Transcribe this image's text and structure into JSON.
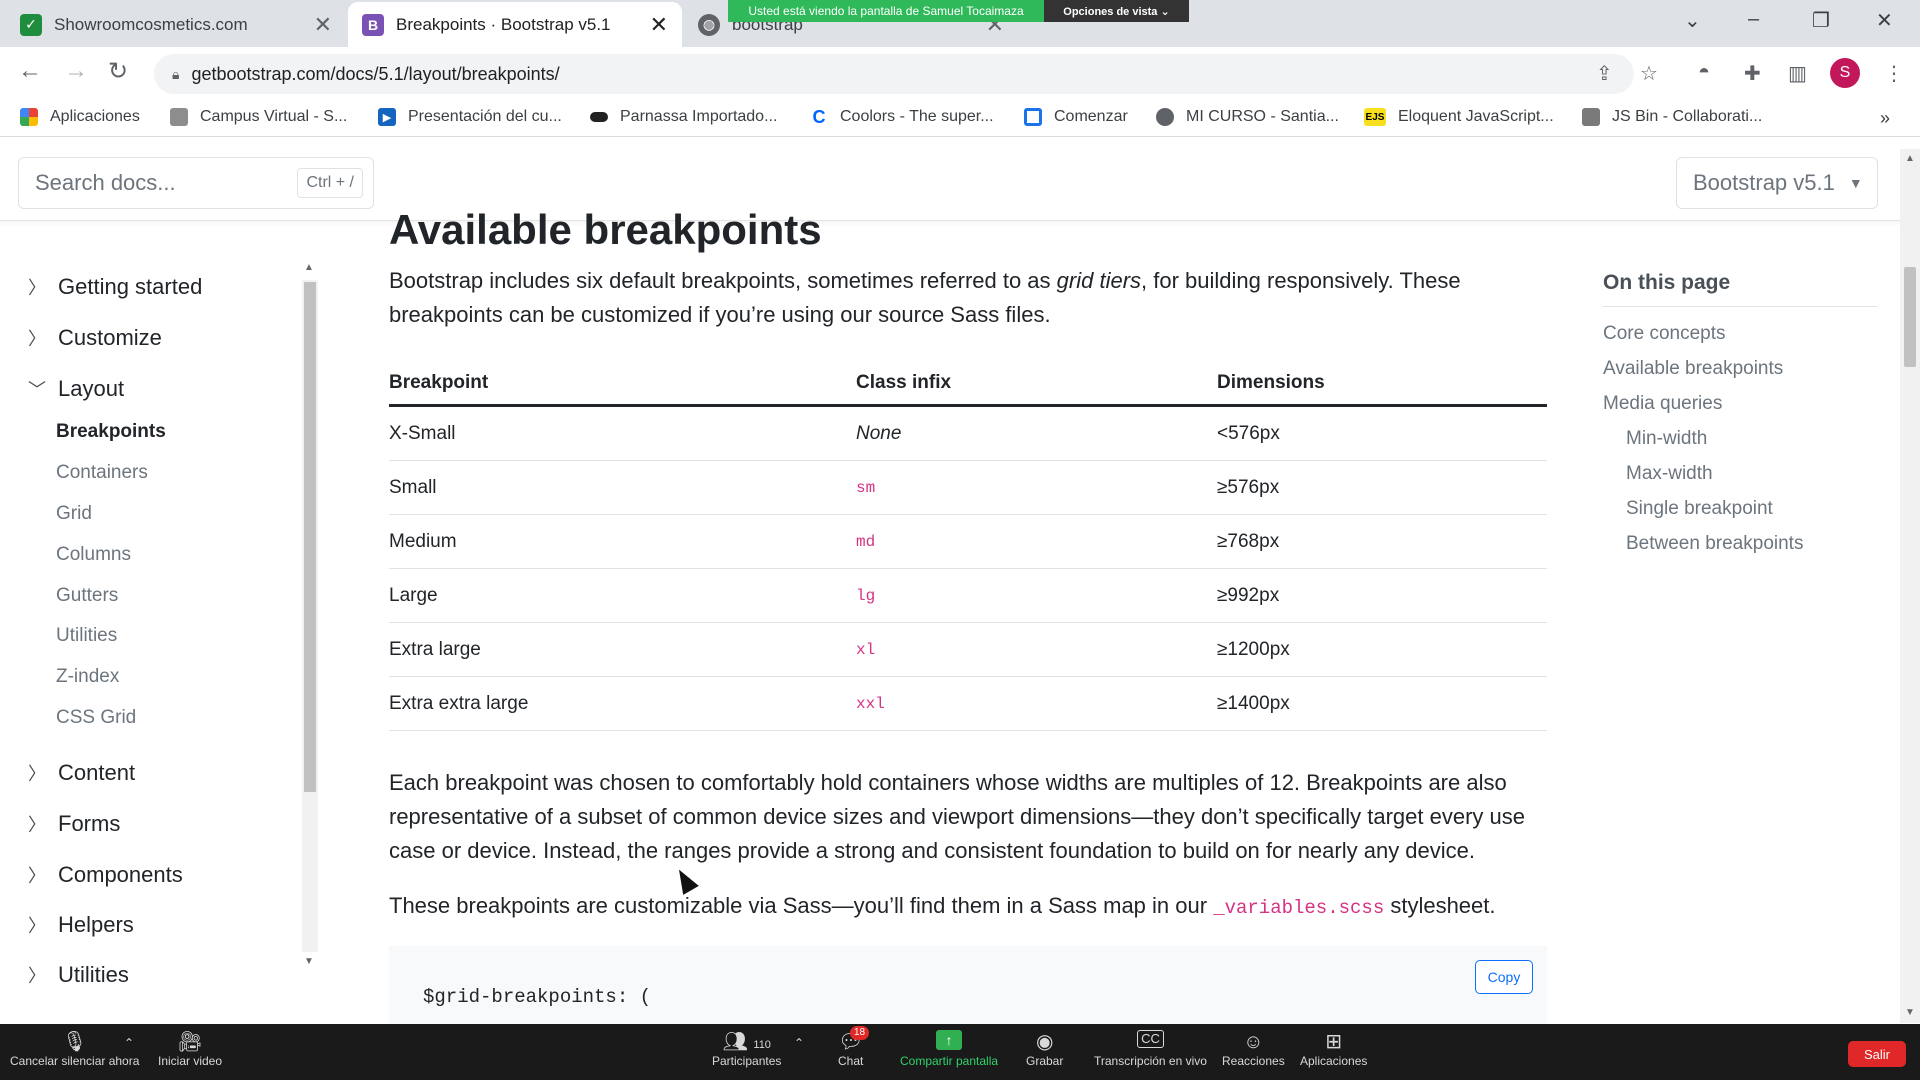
{
  "browser": {
    "tabs": [
      {
        "title": "Showroomcosmetics.com",
        "close": "✕"
      },
      {
        "title": "Breakpoints · Bootstrap v5.1",
        "icon_letter": "B",
        "close": "✕"
      },
      {
        "title": "bootstrap",
        "close": "✕"
      }
    ],
    "share_banner": "Usted está viendo la pantalla de Samuel Tocaimaza",
    "view_options": "Opciones de vista ⌄",
    "url": "getbootstrap.com/docs/5.1/layout/breakpoints/",
    "profile_initial": "S",
    "bookmarks": [
      {
        "label": "Aplicaciones",
        "icon": "apps-grid-icon"
      },
      {
        "label": "Campus Virtual - S...",
        "icon": "campus-icon"
      },
      {
        "label": "Presentación del cu...",
        "icon": "slides-icon"
      },
      {
        "label": "Parnassa Importado...",
        "icon": "parnassa-icon"
      },
      {
        "label": "Coolors - The super...",
        "icon": "coolors-icon"
      },
      {
        "label": "Comenzar",
        "icon": "start-icon"
      },
      {
        "label": "MI CURSO - Santia...",
        "icon": "globe-icon"
      },
      {
        "label": "Eloquent JavaScript...",
        "icon": "ejs-icon",
        "icon_text": "EJS"
      },
      {
        "label": "JS Bin - Collaborati...",
        "icon": "jsbin-icon"
      }
    ]
  },
  "docs": {
    "search_placeholder": "Search docs...",
    "search_shortcut": "Ctrl + /",
    "version": "Bootstrap v5.1"
  },
  "sidebar": {
    "groups": [
      {
        "label": "Getting started",
        "expanded": false
      },
      {
        "label": "Customize",
        "expanded": false
      },
      {
        "label": "Layout",
        "expanded": true
      },
      {
        "label": "Content",
        "expanded": false
      },
      {
        "label": "Forms",
        "expanded": false
      },
      {
        "label": "Components",
        "expanded": false
      },
      {
        "label": "Helpers",
        "expanded": false
      },
      {
        "label": "Utilities",
        "expanded": false
      }
    ],
    "layout_items": [
      "Breakpoints",
      "Containers",
      "Grid",
      "Columns",
      "Gutters",
      "Utilities",
      "Z-index",
      "CSS Grid"
    ],
    "current_item": "Breakpoints"
  },
  "main": {
    "heading": "Available breakpoints",
    "lead_before": "Bootstrap includes six default breakpoints, sometimes referred to as ",
    "lead_em": "grid tiers",
    "lead_after": ", for building responsively. These breakpoints can be customized if you’re using our source Sass files.",
    "table": {
      "headers": [
        "Breakpoint",
        "Class infix",
        "Dimensions"
      ],
      "rows": [
        [
          "X-Small",
          "None",
          "<576px"
        ],
        [
          "Small",
          "sm",
          "≥576px"
        ],
        [
          "Medium",
          "md",
          "≥768px"
        ],
        [
          "Large",
          "lg",
          "≥992px"
        ],
        [
          "Extra large",
          "xl",
          "≥1200px"
        ],
        [
          "Extra extra large",
          "xxl",
          "≥1400px"
        ]
      ]
    },
    "para1": "Each breakpoint was chosen to comfortably hold containers whose widths are multiples of 12. Breakpoints are also representative of a subset of common device sizes and viewport dimensions—they don’t specifically target every use case or device. Instead, the ranges provide a strong and consistent foundation to build on for nearly any device.",
    "para2_before": "These breakpoints are customizable via Sass—you’ll find them in a Sass map in our ",
    "para2_code": "_variables.scss",
    "para2_after": " stylesheet.",
    "code_line": "$grid-breakpoints: (",
    "copy_label": "Copy"
  },
  "toc": {
    "title": "On this page",
    "items": [
      "Core concepts",
      "Available breakpoints",
      "Media queries",
      "Min-width",
      "Max-width",
      "Single breakpoint",
      "Between breakpoints"
    ]
  },
  "meeting": {
    "mute": "Cancelar silenciar ahora",
    "video": "Iniciar video",
    "participants": "Participantes",
    "participants_count": "110",
    "chat": "Chat",
    "chat_badge": "18",
    "share": "Compartir pantalla",
    "record": "Grabar",
    "captions": "Transcripción en vivo",
    "reactions": "Reacciones",
    "apps": "Aplicaciones",
    "leave": "Salir"
  },
  "colors": {
    "bootstrap_purple": "#7952b3",
    "code_pink": "#d63384",
    "zoom_green": "#31b052",
    "leave_red": "#e02828"
  }
}
